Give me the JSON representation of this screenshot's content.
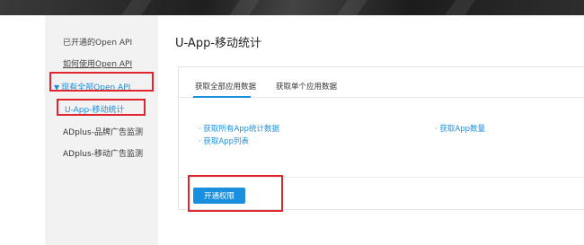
{
  "sidebar": {
    "items": [
      {
        "label": "已开通的Open API"
      },
      {
        "label": "如何使用Open API"
      },
      {
        "label": "现有全部Open API",
        "caret": "▼"
      },
      {
        "label": "U-App-移动统计"
      },
      {
        "label": "ADplus-品牌广告监测"
      },
      {
        "label": "ADplus-移动广告监测"
      }
    ]
  },
  "main": {
    "title": "U-App-移动统计",
    "tabs": [
      {
        "label": "获取全部应用数据"
      },
      {
        "label": "获取单个应用数据"
      }
    ],
    "api_links": [
      {
        "label": "· 获取所有App统计数据"
      },
      {
        "label": "· 获取App列表"
      },
      {
        "label": "· 获取App数量"
      }
    ],
    "open_button": "开通权限"
  },
  "colors": {
    "accent": "#1a8fe0",
    "highlight_border": "#e0262c",
    "sidebar_bg": "#f2f2f2"
  }
}
